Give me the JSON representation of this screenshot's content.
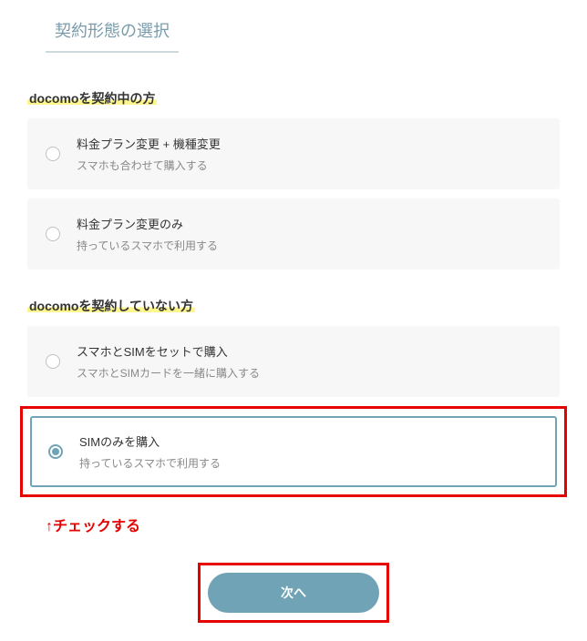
{
  "section": {
    "title": "契約形態の選択"
  },
  "groups": [
    {
      "label": "docomoを契約中の方",
      "options": [
        {
          "title": "料金プラン変更 + 機種変更",
          "subtitle": "スマホも合わせて購入する",
          "selected": false
        },
        {
          "title": "料金プラン変更のみ",
          "subtitle": "持っているスマホで利用する",
          "selected": false
        }
      ]
    },
    {
      "label": "docomoを契約していない方",
      "options": [
        {
          "title": "スマホとSIMをセットで購入",
          "subtitle": "スマホとSIMカードを一緒に購入する",
          "selected": false
        },
        {
          "title": "SIMのみを購入",
          "subtitle": "持っているスマホで利用する",
          "selected": true
        }
      ]
    }
  ],
  "annotation": "↑チェックする",
  "buttons": {
    "next": "次へ"
  }
}
